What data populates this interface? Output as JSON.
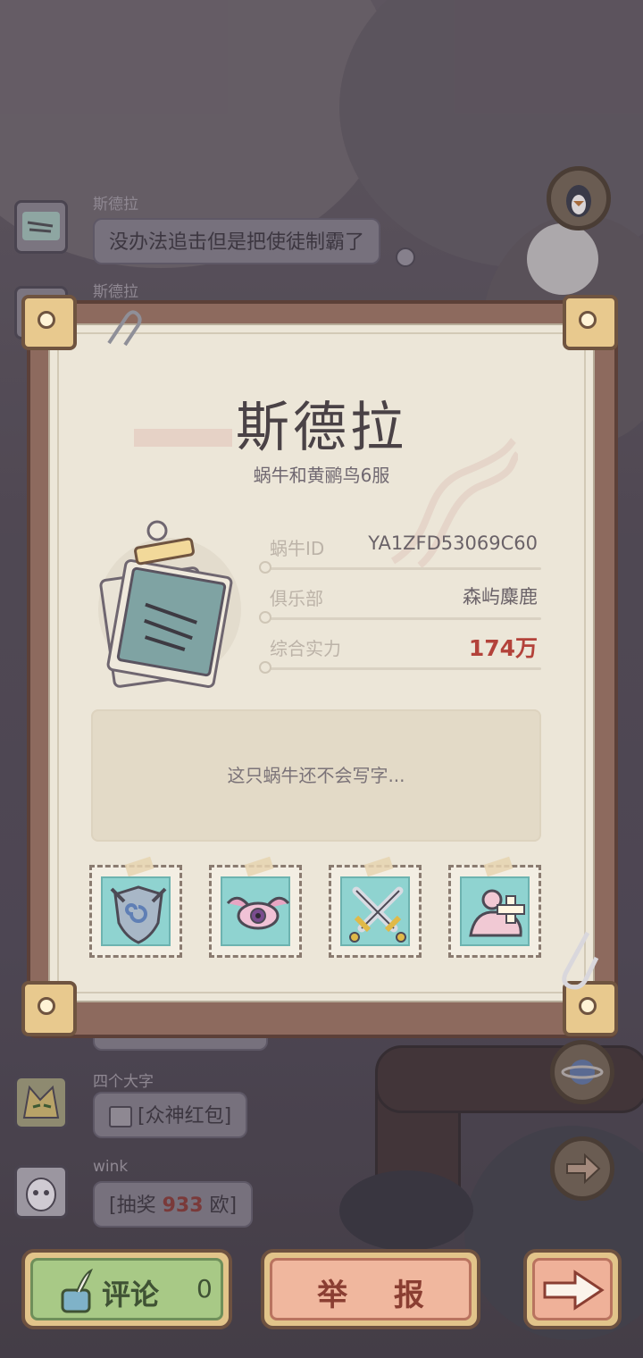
{
  "chat": {
    "messages": [
      {
        "user": "斯德拉",
        "text": "没办法追击但是把使徒制霸了"
      },
      {
        "user": "斯德拉"
      },
      {
        "user": "四个大字",
        "text": "[众神红包]"
      },
      {
        "user": "wink",
        "text_prefix": "[抽奖 ",
        "text_amount": "933",
        "text_suffix": " 欧]"
      }
    ]
  },
  "profile": {
    "name": "斯德拉",
    "server": "蜗牛和黄鹂鸟6服",
    "rows": [
      {
        "label": "蜗牛ID",
        "value": "YA1ZFD53069C60"
      },
      {
        "label": "俱乐部",
        "value": "森屿麋鹿"
      },
      {
        "label": "综合实力",
        "value": "174万"
      }
    ],
    "bio": "这只蜗牛还不会写字...",
    "badges": [
      "shield-badge",
      "winged-eye-badge",
      "crossed-swords-badge",
      "snail-heal-badge"
    ]
  },
  "bottom": {
    "comment_label": "评论",
    "comment_count": "0",
    "report_label": "举 报"
  },
  "colors": {
    "power": "#b3423a",
    "comment_green": "#a8c986",
    "report_pink": "#f0b79e",
    "frame_brown": "#8d6a5e",
    "paper": "#ece6d8"
  }
}
